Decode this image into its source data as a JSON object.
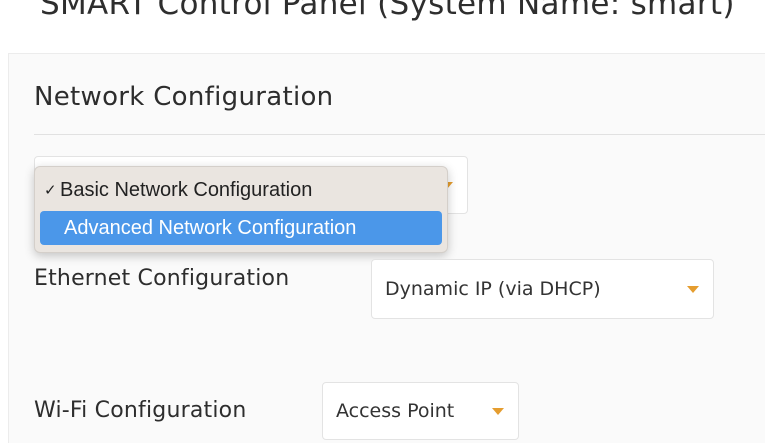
{
  "page": {
    "app_title": "SMART Control Panel (System Name: smart)"
  },
  "section": {
    "title": "Network Configuration"
  },
  "mode_select": {
    "options": [
      {
        "label": "Basic Network Configuration",
        "checked": true,
        "highlighted": false
      },
      {
        "label": "Advanced Network Configuration",
        "checked": false,
        "highlighted": true
      }
    ],
    "check_glyph": "✓"
  },
  "ethernet": {
    "label": "Ethernet Configuration",
    "value": "Dynamic IP (via DHCP)"
  },
  "wifi": {
    "label": "Wi-Fi Configuration",
    "value": "Access Point"
  },
  "colors": {
    "accent_caret": "#e59d2f",
    "menu_highlight": "#4b97e9",
    "menu_background": "#eae5e0"
  },
  "icons": {
    "dropdown": "caret-down-icon",
    "selected": "checkmark-icon"
  }
}
